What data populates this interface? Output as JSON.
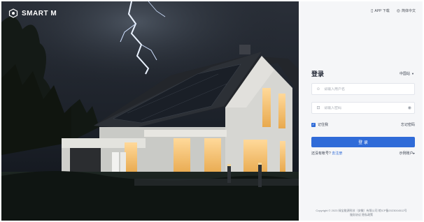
{
  "brand": {
    "name": "SMART M",
    "logo_icon": "hexagon-logo-icon"
  },
  "topbar": {
    "app_download": {
      "icon": "phone-icon",
      "label": "APP 下载"
    },
    "language": {
      "icon": "globe-icon",
      "label": "简体中文"
    }
  },
  "login": {
    "title": "登录",
    "site": "中国站",
    "username_placeholder": "请输入用户名",
    "password_placeholder": "请输入密码",
    "remember": "记住我",
    "forgot": "忘记密码",
    "submit": "登 录",
    "no_account": "还没有帐号?",
    "register": "去注册",
    "demo": "示例账户"
  },
  "footer": {
    "copyright": "Copyright © 2023 绿宝能源科技（安徽）有限公司 皖ICP备2023004512号",
    "links": "服务协议  隐私政策"
  },
  "colors": {
    "primary": "#2f6bd8",
    "panel_bg": "#f5f6f8",
    "sky": "#1a1f27"
  }
}
